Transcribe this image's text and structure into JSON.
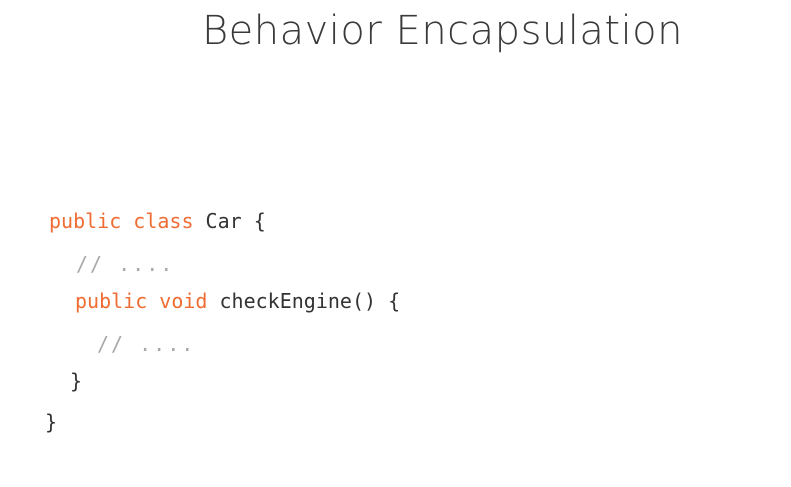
{
  "slide": {
    "title": "Behavior Encapsulation"
  },
  "code": {
    "line1": {
      "kw": "public class",
      "rest": " Car {"
    },
    "line2": {
      "comment": "// ...."
    },
    "line3": {
      "kw": "public void",
      "rest": " checkEngine() {"
    },
    "line4": {
      "comment": "// ...."
    },
    "line5": {
      "rest": "}"
    },
    "line6": {
      "rest": "}"
    }
  },
  "colors": {
    "keyword": "#ef6c33",
    "text": "#333333",
    "comment": "#a9a9a9",
    "title": "#3a3a3a"
  }
}
